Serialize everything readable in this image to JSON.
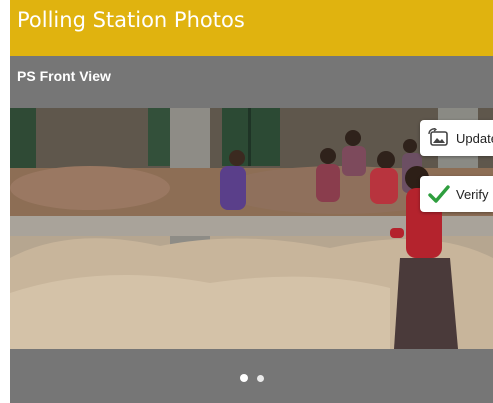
{
  "header": {
    "title": "Polling Station Photos"
  },
  "card": {
    "title": "PS Front View",
    "actions": {
      "update_label": "Update",
      "verify_label": "Verify"
    },
    "carousel": {
      "active_index": 0,
      "dots": [
        {},
        {}
      ]
    }
  },
  "colors": {
    "header_bg": "#e0b30f",
    "card_bg": "#767676",
    "verify_check": "#2e9e3e"
  },
  "icons": {
    "update": "image-refresh-icon",
    "verify": "checkmark-icon"
  }
}
